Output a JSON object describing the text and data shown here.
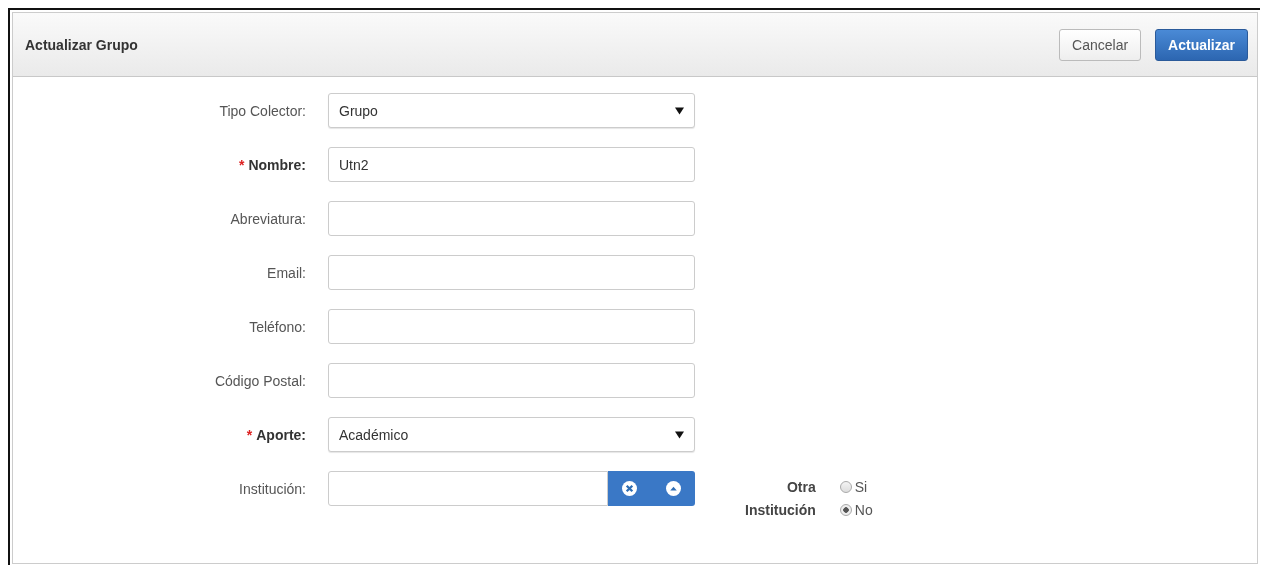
{
  "header": {
    "title": "Actualizar Grupo",
    "buttons": [
      {
        "label": "Cancelar",
        "kind": "default"
      },
      {
        "label": "Actualizar",
        "kind": "primary"
      }
    ]
  },
  "fields": [
    {
      "label": "Tipo Colector:",
      "kind": "select",
      "required": false,
      "value": "Grupo"
    },
    {
      "label": "Nombre:",
      "kind": "text",
      "required": true,
      "required_mark": "*",
      "value": "Utn2"
    },
    {
      "label": "Abreviatura:",
      "kind": "text",
      "required": false
    },
    {
      "label": "Email:",
      "kind": "text",
      "required": false
    },
    {
      "label": "Teléfono:",
      "kind": "text",
      "required": false
    },
    {
      "label": "Código Postal:",
      "kind": "text",
      "required": false
    },
    {
      "label": "Aporte:",
      "kind": "select",
      "required": true,
      "required_mark": "*",
      "value": "Académico"
    },
    {
      "label": "Institución:",
      "kind": "lookup",
      "required": false
    }
  ],
  "other_institution": {
    "label_lines": [
      "Otra",
      "Institución"
    ],
    "options": [
      {
        "label": "Si",
        "selected": false
      },
      {
        "label": "No",
        "selected": true
      }
    ]
  }
}
